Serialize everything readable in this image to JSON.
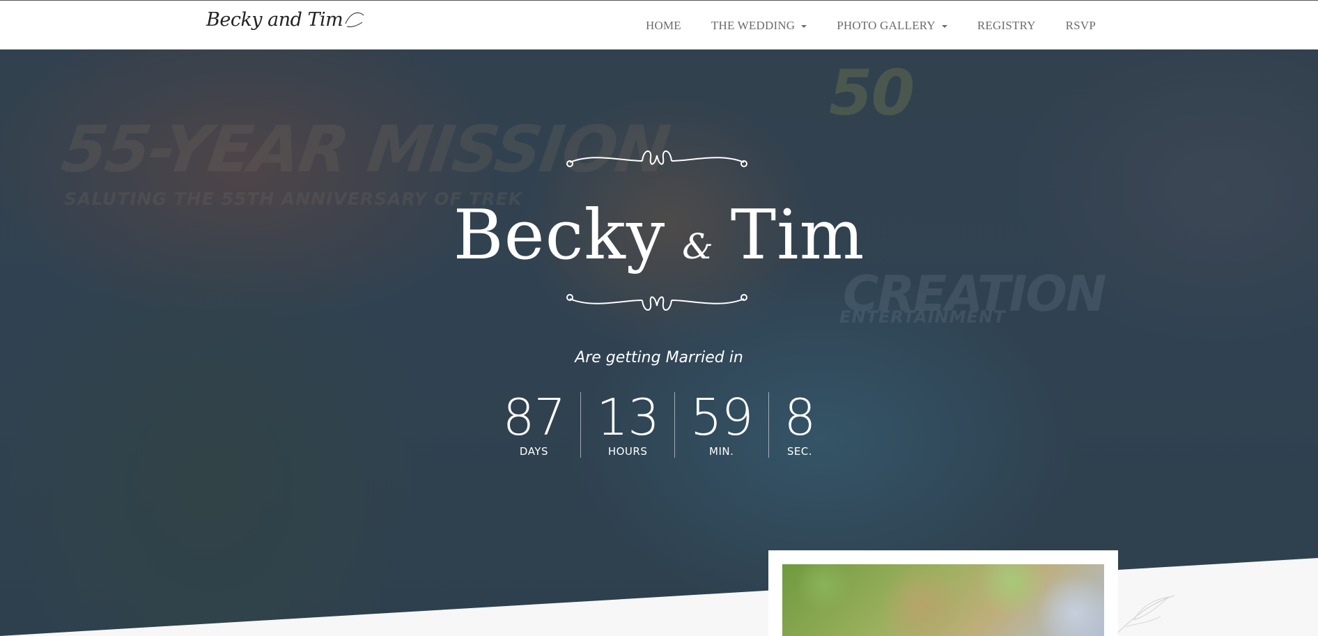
{
  "header": {
    "logo_text": "Becky and Tim",
    "nav": [
      {
        "label": "HOME",
        "has_dropdown": false
      },
      {
        "label": "THE WEDDING",
        "has_dropdown": true
      },
      {
        "label": "PHOTO GALLERY",
        "has_dropdown": true
      },
      {
        "label": "REGISTRY",
        "has_dropdown": false
      },
      {
        "label": "RSVP",
        "has_dropdown": false
      }
    ]
  },
  "hero": {
    "name_1": "Becky",
    "ampersand": "&",
    "name_2": "Tim",
    "subtitle": "Are getting Married in",
    "countdown": [
      {
        "value": "87",
        "label": "DAYS"
      },
      {
        "value": "13",
        "label": "HOURS"
      },
      {
        "value": "59",
        "label": "MIN."
      },
      {
        "value": "8",
        "label": "SEC."
      }
    ],
    "background_text": {
      "mission": "55-YEAR MISSION",
      "saluting": "SALUTING THE 55TH ANNIVERSARY OF TREK",
      "anniversary_badge": "50",
      "creation": "CREATION",
      "entertainment": "ENTERTAINMENT"
    }
  },
  "colors": {
    "nav_text": "#6b6b6b",
    "hero_text": "#ffffff",
    "section_bg": "#f7f7f7"
  }
}
